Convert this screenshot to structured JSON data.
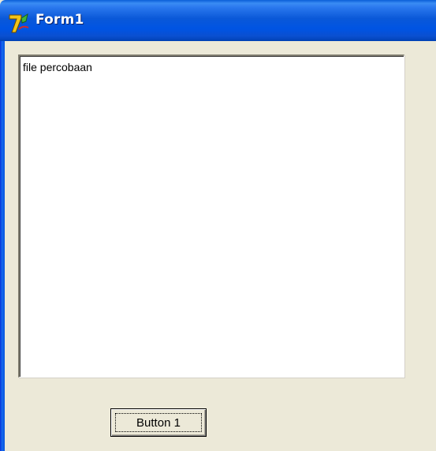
{
  "window": {
    "title": "Form1",
    "icon": "delphi-7-icon"
  },
  "memo": {
    "text": "file percobaan"
  },
  "button": {
    "label": "Button 1"
  },
  "colors": {
    "titlebar": "#0054e3",
    "window_face": "#ece9d8",
    "memo_background": "#ffffff"
  }
}
